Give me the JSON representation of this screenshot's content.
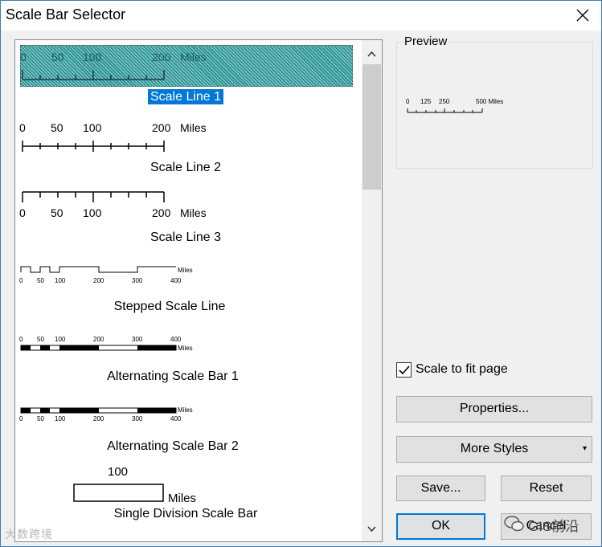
{
  "window": {
    "title": "Scale Bar Selector",
    "close_icon": "close-icon"
  },
  "list": {
    "items": [
      {
        "label": "Scale Line 1",
        "selected": true,
        "ticks": [
          "0",
          "50",
          "100",
          "200"
        ],
        "unit": "Miles"
      },
      {
        "label": "Scale Line 2",
        "ticks": [
          "0",
          "50",
          "100",
          "200"
        ],
        "unit": "Miles"
      },
      {
        "label": "Scale Line 3",
        "ticks": [
          "0",
          "50",
          "100",
          "200"
        ],
        "unit": "Miles"
      },
      {
        "label": "Stepped Scale Line",
        "ticks": [
          "0",
          "50",
          "100",
          "200",
          "300",
          "400"
        ],
        "unit": "Miles"
      },
      {
        "label": "Alternating Scale Bar 1",
        "ticks": [
          "0",
          "50",
          "100",
          "200",
          "300",
          "400"
        ],
        "unit": "Miles"
      },
      {
        "label": "Alternating Scale Bar 2",
        "ticks": [
          "0",
          "50",
          "100",
          "200",
          "300",
          "400"
        ],
        "unit": "Miles"
      },
      {
        "label": "Single Division Scale Bar",
        "ticks": [
          "100"
        ],
        "unit": "Miles"
      }
    ]
  },
  "preview": {
    "title": "Preview",
    "ticks": [
      "0",
      "125",
      "250",
      "500 Miles"
    ]
  },
  "options": {
    "scale_to_fit_label": "Scale to fit page",
    "scale_to_fit_checked": true
  },
  "buttons": {
    "properties": "Properties...",
    "more_styles": "More Styles",
    "save": "Save...",
    "reset": "Reset",
    "ok": "OK",
    "cancel": "Cancel"
  },
  "overlay": {
    "left_watermark": "大数跨境",
    "right_watermark": "GIS前沿"
  }
}
